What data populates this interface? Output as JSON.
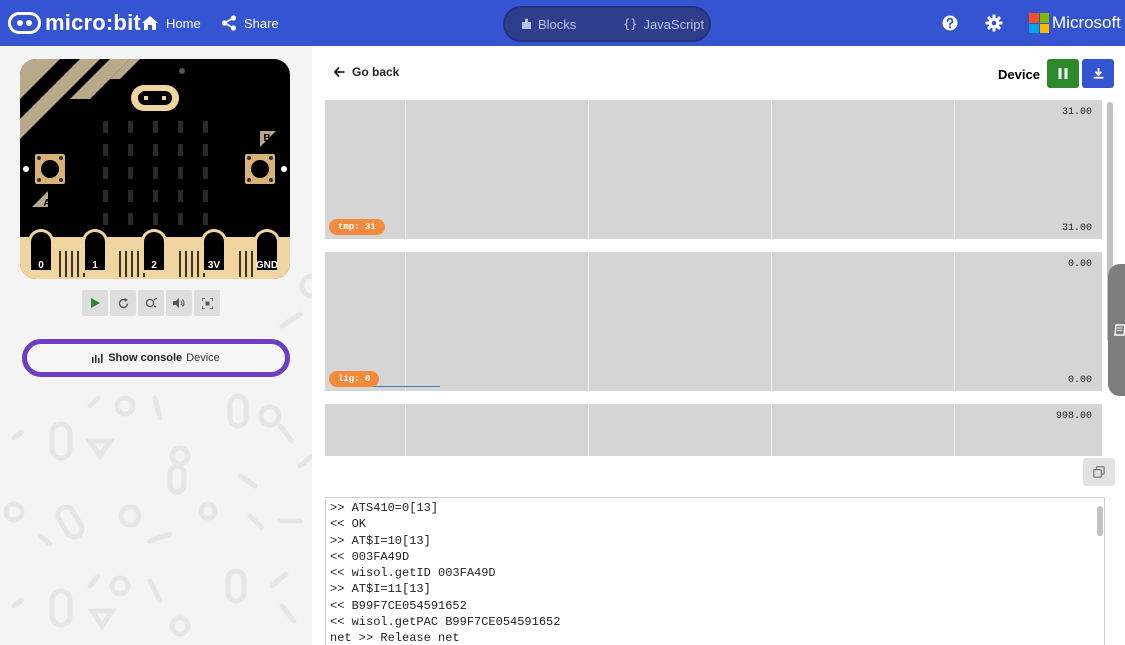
{
  "topbar": {
    "logo_text": "micro:bit",
    "home_label": "Home",
    "share_label": "Share",
    "blocks_label": "Blocks",
    "javascript_label": "JavaScript",
    "microsoft_label": "Microsoft",
    "bg_color": "#3454d1"
  },
  "simulator": {
    "pins": [
      "0",
      "1",
      "2",
      "3V",
      "GND"
    ],
    "button_a": "A",
    "button_b": "B",
    "tools": [
      "play-icon",
      "restart-icon",
      "slow-motion-icon",
      "mute-icon",
      "fullscreen-icon"
    ],
    "console_button": {
      "label": "Show console",
      "sublabel": "Device"
    }
  },
  "serial": {
    "back_label": "Go back",
    "device_label": "Device",
    "charts": [
      {
        "tag": "tmp: 31",
        "max": "31.00",
        "min": "31.00"
      },
      {
        "tag": "lig: 0",
        "max": "0.00",
        "min": "0.00"
      },
      {
        "tag": "",
        "max": "998.00",
        "min": ""
      }
    ],
    "console_lines": [
      ">> ATS410=0[13]",
      "<< OK",
      ">> AT$I=10[13]",
      "<< 003FA49D",
      "<< wisol.getID 003FA49D",
      ">> AT$I=11[13]",
      "<< B99F7CE054591652",
      "<< wisol.getPAC B99F7CE054591652",
      "net >> Release net"
    ]
  },
  "colors": {
    "pause_green": "#2c8a2c",
    "download_blue": "#3454d1",
    "console_ring": "#6b3fbf",
    "tag_orange": "#f48a3c",
    "pin_gold": "#f1d5a0"
  }
}
